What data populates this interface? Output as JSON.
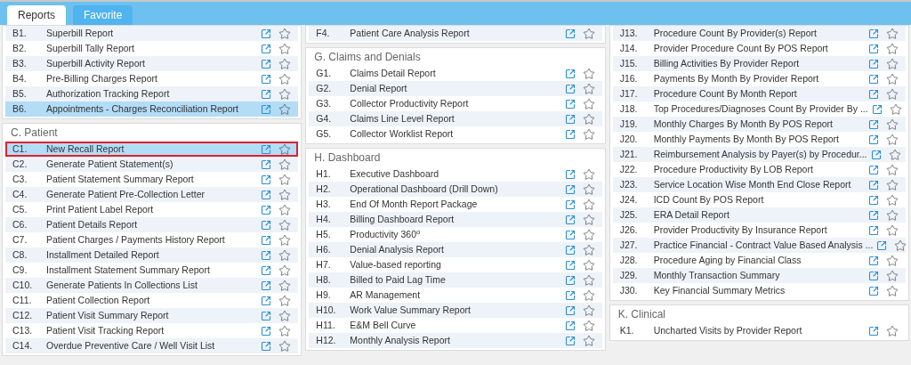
{
  "tabs": [
    {
      "label": "Reports",
      "selected": true
    },
    {
      "label": "Favorite",
      "selected": false
    }
  ],
  "columns": [
    {
      "sections": [
        {
          "items": [
            {
              "code": "B1.",
              "name": "Superbill Report",
              "selected": false,
              "focused": false,
              "favorite": false
            },
            {
              "code": "B2.",
              "name": "Superbill Tally Report",
              "selected": false,
              "focused": false,
              "favorite": false
            },
            {
              "code": "B3.",
              "name": "Superbill Activity Report",
              "selected": false,
              "focused": false,
              "favorite": false
            },
            {
              "code": "B4.",
              "name": "Pre-Billing Charges Report",
              "selected": false,
              "focused": false,
              "favorite": false
            },
            {
              "code": "B5.",
              "name": "Authorization Tracking Report",
              "selected": false,
              "focused": false,
              "favorite": false
            },
            {
              "code": "B6.",
              "name": "Appointments - Charges Reconciliation Report",
              "selected": true,
              "focused": false,
              "favorite": false
            }
          ]
        },
        {
          "title": "C. Patient",
          "items": [
            {
              "code": "C1.",
              "name": "New Recall Report",
              "selected": true,
              "focused": true,
              "favorite": false
            },
            {
              "code": "C2.",
              "name": "Generate Patient Statement(s)",
              "selected": false,
              "focused": false,
              "favorite": false
            },
            {
              "code": "C3.",
              "name": "Patient Statement Summary Report",
              "selected": false,
              "focused": false,
              "favorite": false
            },
            {
              "code": "C4.",
              "name": "Generate Patient Pre-Collection Letter",
              "selected": false,
              "focused": false,
              "favorite": false
            },
            {
              "code": "C5.",
              "name": "Print Patient Label Report",
              "selected": false,
              "focused": false,
              "favorite": false
            },
            {
              "code": "C6.",
              "name": "Patient Details Report",
              "selected": false,
              "focused": false,
              "favorite": false
            },
            {
              "code": "C7.",
              "name": "Patient Charges / Payments History Report",
              "selected": false,
              "focused": false,
              "favorite": false
            },
            {
              "code": "C8.",
              "name": "Installment Detailed Report",
              "selected": false,
              "focused": false,
              "favorite": false
            },
            {
              "code": "C9.",
              "name": "Installment Statement Summary Report",
              "selected": false,
              "focused": false,
              "favorite": false
            },
            {
              "code": "C10.",
              "name": "Generate Patients In Collections List",
              "selected": false,
              "focused": false,
              "favorite": false
            },
            {
              "code": "C11.",
              "name": "Patient Collection Report",
              "selected": false,
              "focused": false,
              "favorite": false
            },
            {
              "code": "C12.",
              "name": "Patient Visit Summary Report",
              "selected": false,
              "focused": false,
              "favorite": false
            },
            {
              "code": "C13.",
              "name": "Patient Visit Tracking Report",
              "selected": false,
              "focused": false,
              "favorite": false
            },
            {
              "code": "C14.",
              "name": "Overdue Preventive Care / Well Visit List",
              "selected": false,
              "focused": false,
              "favorite": false
            }
          ]
        }
      ]
    },
    {
      "sections": [
        {
          "items": [
            {
              "code": "F4.",
              "name": "Patient Care Analysis Report",
              "selected": false,
              "focused": false,
              "favorite": false
            }
          ]
        },
        {
          "title": "G. Claims and Denials",
          "items": [
            {
              "code": "G1.",
              "name": "Claims Detail Report",
              "selected": false,
              "focused": false,
              "favorite": false
            },
            {
              "code": "G2.",
              "name": "Denial Report",
              "selected": false,
              "focused": false,
              "favorite": false
            },
            {
              "code": "G3.",
              "name": "Collector Productivity Report",
              "selected": false,
              "focused": false,
              "favorite": false
            },
            {
              "code": "G4.",
              "name": "Claims Line Level Report",
              "selected": false,
              "focused": false,
              "favorite": false
            },
            {
              "code": "G5.",
              "name": "Collector Worklist Report",
              "selected": false,
              "focused": false,
              "favorite": false
            }
          ]
        },
        {
          "title": "H. Dashboard",
          "items": [
            {
              "code": "H1.",
              "name": "Executive Dashboard",
              "selected": false,
              "focused": false,
              "favorite": false
            },
            {
              "code": "H2.",
              "name": "Operational Dashboard (Drill Down)",
              "selected": false,
              "focused": false,
              "favorite": false
            },
            {
              "code": "H3.",
              "name": "End Of Month Report Package",
              "selected": false,
              "focused": false,
              "favorite": false
            },
            {
              "code": "H4.",
              "name": "Billing Dashboard Report",
              "selected": false,
              "focused": false,
              "favorite": false
            },
            {
              "code": "H5.",
              "name": "Productivity 360$^{o}$",
              "selected": false,
              "focused": false,
              "favorite": false
            },
            {
              "code": "H6.",
              "name": "Denial Analysis Report",
              "selected": false,
              "focused": false,
              "favorite": false
            },
            {
              "code": "H7.",
              "name": "Value-based reporting",
              "selected": false,
              "focused": false,
              "favorite": false
            },
            {
              "code": "H8.",
              "name": "Billed to Paid Lag Time",
              "selected": false,
              "focused": false,
              "favorite": false
            },
            {
              "code": "H9.",
              "name": "AR Management",
              "selected": false,
              "focused": false,
              "favorite": false
            },
            {
              "code": "H10.",
              "name": "Work Value Summary Report",
              "selected": false,
              "focused": false,
              "favorite": false
            },
            {
              "code": "H11.",
              "name": "E&M Bell Curve",
              "selected": false,
              "focused": false,
              "favorite": false
            },
            {
              "code": "H12.",
              "name": "Monthly Analysis Report",
              "selected": false,
              "focused": false,
              "favorite": false
            }
          ]
        }
      ]
    },
    {
      "sections": [
        {
          "items": [
            {
              "code": "J13.",
              "name": "Procedure Count By Provider(s) Report",
              "selected": false,
              "focused": false,
              "favorite": false
            },
            {
              "code": "J14.",
              "name": "Provider Procedure Count By POS Report",
              "selected": false,
              "focused": false,
              "favorite": false
            },
            {
              "code": "J15.",
              "name": "Billing Activities By Provider Report",
              "selected": false,
              "focused": false,
              "favorite": false
            },
            {
              "code": "J16.",
              "name": "Payments By Month By Provider Report",
              "selected": false,
              "focused": false,
              "favorite": false
            },
            {
              "code": "J17.",
              "name": "Procedure Count By Month Report",
              "selected": false,
              "focused": false,
              "favorite": false
            },
            {
              "code": "J18.",
              "name": "Top Procedures/Diagnoses Count By Provider By ...",
              "selected": false,
              "focused": false,
              "favorite": false
            },
            {
              "code": "J19.",
              "name": "Monthly Charges By Month By POS Report",
              "selected": false,
              "focused": false,
              "favorite": false
            },
            {
              "code": "J20.",
              "name": "Monthly Payments By Month By POS Report",
              "selected": false,
              "focused": false,
              "favorite": false
            },
            {
              "code": "J21.",
              "name": "Reimbursement Analysis by Payer(s) by Procedur...",
              "selected": false,
              "focused": false,
              "favorite": false
            },
            {
              "code": "J22.",
              "name": "Procedure Productivity By LOB Report",
              "selected": false,
              "focused": false,
              "favorite": false
            },
            {
              "code": "J23.",
              "name": "Service Location Wise Month End Close Report",
              "selected": false,
              "focused": false,
              "favorite": false
            },
            {
              "code": "J24.",
              "name": "ICD Count By POS Report",
              "selected": false,
              "focused": false,
              "favorite": false
            },
            {
              "code": "J25.",
              "name": "ERA Detail Report",
              "selected": false,
              "focused": false,
              "favorite": false
            },
            {
              "code": "J26.",
              "name": "Provider Productivity By Insurance Report",
              "selected": false,
              "focused": false,
              "favorite": false
            },
            {
              "code": "J27.",
              "name": "Practice Financial - Contract Value Based Analysis ...",
              "selected": false,
              "focused": false,
              "favorite": false
            },
            {
              "code": "J28.",
              "name": "Procedure Aging by Financial Class",
              "selected": false,
              "focused": false,
              "favorite": false
            },
            {
              "code": "J29.",
              "name": "Monthly Transaction Summary",
              "selected": false,
              "focused": false,
              "favorite": false
            },
            {
              "code": "J30.",
              "name": "Key Financial Summary Metrics",
              "selected": false,
              "focused": false,
              "favorite": false
            }
          ]
        },
        {
          "title": "K. Clinical",
          "items": [
            {
              "code": "K1.",
              "name": "Uncharted Visits by Provider Report",
              "selected": false,
              "focused": false,
              "favorite": false
            }
          ]
        }
      ]
    }
  ]
}
